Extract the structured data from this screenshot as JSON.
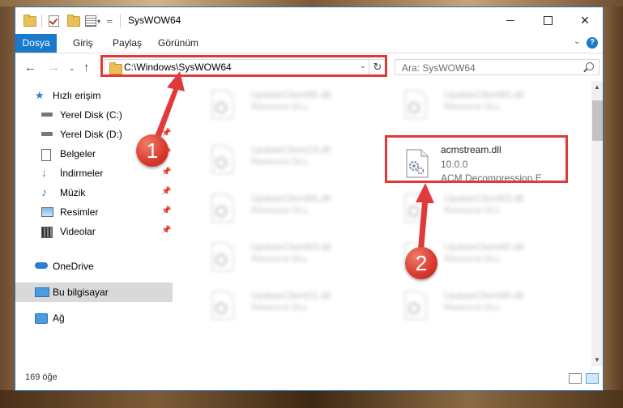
{
  "window": {
    "title": "SysWOW64",
    "controls": {
      "minimize": "minimize",
      "maximize": "maximize",
      "close": "✕"
    }
  },
  "ribbon": {
    "tabs": [
      "Dosya",
      "Giriş",
      "Paylaş",
      "Görünüm"
    ],
    "help": "?"
  },
  "nav": {
    "address": "C:\\Windows\\SysWOW64",
    "search_placeholder": "Ara: SysWOW64"
  },
  "sidebar": {
    "items": [
      {
        "label": "Hızlı erişim",
        "icon": "star-icon",
        "pinned": false
      },
      {
        "label": "Yerel Disk (C:)",
        "icon": "drive-icon",
        "pinned": true
      },
      {
        "label": "Yerel Disk (D:)",
        "icon": "drive-icon",
        "pinned": true
      },
      {
        "label": "Belgeler",
        "icon": "document-icon",
        "pinned": true
      },
      {
        "label": "İndirmeler",
        "icon": "download-icon",
        "pinned": true
      },
      {
        "label": "Müzik",
        "icon": "music-icon",
        "pinned": true
      },
      {
        "label": "Resimler",
        "icon": "pictures-icon",
        "pinned": true
      },
      {
        "label": "Videolar",
        "icon": "video-icon",
        "pinned": true
      },
      {
        "label": "OneDrive",
        "icon": "cloud-icon",
        "pinned": false
      },
      {
        "label": "Bu bilgisayar",
        "icon": "computer-icon",
        "pinned": false,
        "selected": true
      },
      {
        "label": "Ağ",
        "icon": "network-icon",
        "pinned": false
      }
    ]
  },
  "files": {
    "left": [
      {
        "name": "UpdateClient65.dll",
        "desc": "Resource DLL"
      },
      {
        "name": "UpdateClient19.dll",
        "desc": "Resource DLL"
      },
      {
        "name": "UpdateClient65.dll",
        "desc": "Resource DLL"
      },
      {
        "name": "UpdateClient63.dll",
        "desc": "Resource DLL"
      },
      {
        "name": "UpdateClient21.dll",
        "desc": "Resource DLL"
      }
    ],
    "right": [
      {
        "name": "UpdateClient65.dll",
        "desc": "Resource DLL"
      },
      {
        "name": "UpdateClient63.dll",
        "desc": "Resource DLL"
      },
      {
        "name": "UpdateClient42.dll",
        "desc": "Resource DLL"
      },
      {
        "name": "UpdateClient65.dll",
        "desc": "Resource DLL"
      }
    ],
    "featured": {
      "name": "acmstream.dll",
      "version": "10.0.0",
      "desc": "ACM Decompression E..."
    }
  },
  "status": {
    "count": "169 öğe"
  },
  "annotations": {
    "marker1": "1",
    "marker2": "2",
    "color": "#e03a3a"
  },
  "colors": {
    "accent": "#1979ca",
    "selection": "#d9d9d9"
  }
}
